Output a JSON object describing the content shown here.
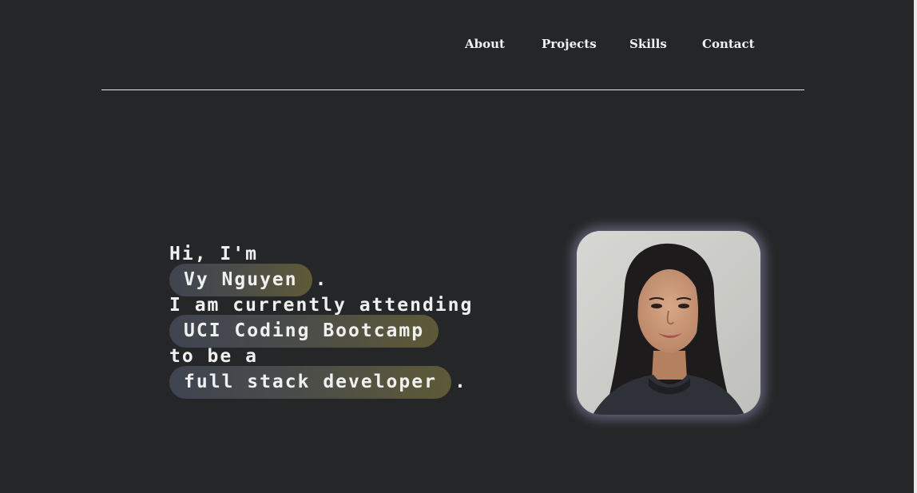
{
  "nav": {
    "items": [
      {
        "label": "About"
      },
      {
        "label": "Projects"
      },
      {
        "label": "Skills"
      },
      {
        "label": "Contact"
      }
    ]
  },
  "hero": {
    "greeting": "Hi, I'm",
    "name": "Vy Nguyen",
    "name_suffix": ".",
    "attending_text": "I am currently attending",
    "school": "UCI Coding Bootcamp",
    "goal_prefix": "to be a",
    "role": "full stack developer",
    "role_suffix": "."
  },
  "colors": {
    "background": "#252628",
    "text": "#f0f0f0",
    "pill_gradient_start": "#3f4451",
    "pill_gradient_end": "#5e5a37",
    "photo_glow": "#c8c8ff"
  },
  "icons": {
    "photo": "profile-photo"
  }
}
